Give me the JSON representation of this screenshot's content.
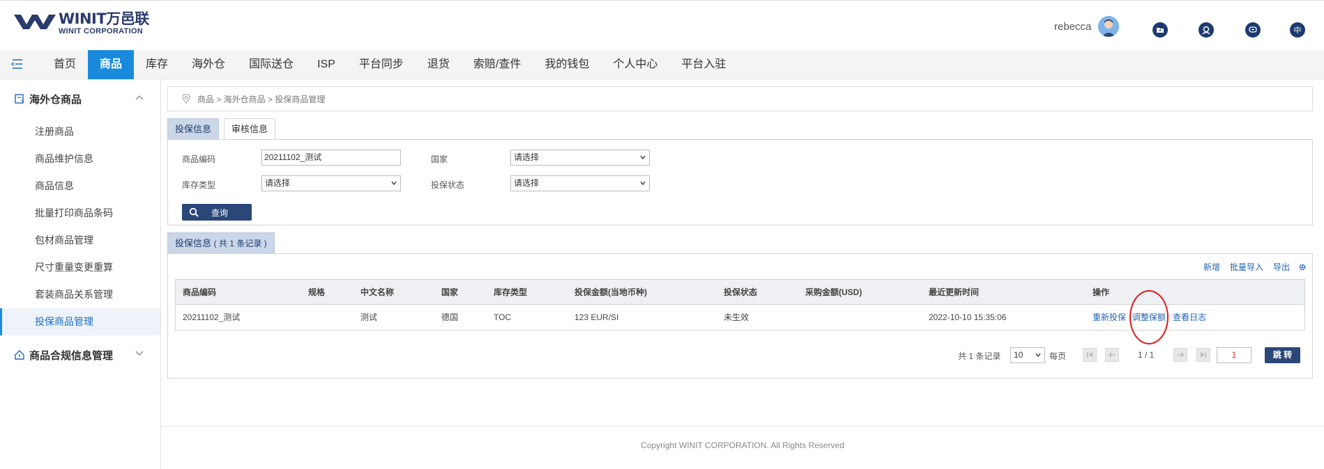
{
  "header": {
    "brand": "WINIT万邑联",
    "brand_sub": "WINIT CORPORATION",
    "user_name": "rebecca",
    "lang_label": "中"
  },
  "nav": {
    "items": [
      "首页",
      "商品",
      "库存",
      "海外仓",
      "国际送仓",
      "ISP",
      "平台同步",
      "退货",
      "索赔/查件",
      "我的钱包",
      "个人中心",
      "平台入驻"
    ],
    "active": "商品"
  },
  "sidebar": {
    "group1": "海外仓商品",
    "items": [
      "注册商品",
      "商品维护信息",
      "商品信息",
      "批量打印商品条码",
      "包材商品管理",
      "尺寸重量变更重算",
      "套装商品关系管理",
      "投保商品管理"
    ],
    "active": "投保商品管理",
    "group2": "商品合规信息管理"
  },
  "breadcrumb": "商品 > 海外仓商品 > 投保商品管理",
  "tabs": [
    "投保信息",
    "审核信息"
  ],
  "search": {
    "product_code_label": "商品编码",
    "product_code_value": "20211102_测试",
    "country_label": "国家",
    "country_value": "请选择",
    "stock_type_label": "库存类型",
    "stock_type_value": "请选择",
    "insure_status_label": "投保状态",
    "insure_status_value": "请选择",
    "query_label": "查询"
  },
  "result": {
    "tab_label": "投保信息",
    "count_label": "( 共 1 条记录 )",
    "toolbar": [
      "新增",
      "批量导入",
      "导出"
    ],
    "columns": [
      "商品编码",
      "规格",
      "中文名称",
      "国家",
      "库存类型",
      "投保金额(当地币种)",
      "投保状态",
      "采购金额(USD)",
      "最近更新时间",
      "操作"
    ],
    "rows": [
      {
        "code": "20211102_测试",
        "spec": "",
        "name": "测试",
        "country": "德国",
        "stock_type": "TOC",
        "amount": "123 EUR/SI",
        "status": "未生效",
        "purchase": "",
        "updated": "2022-10-10 15:35:06",
        "ops": [
          "重新投保",
          "调整保额",
          "查看日志"
        ]
      }
    ]
  },
  "pagination": {
    "total_label": "共 1 条记录",
    "page_size": "10",
    "per_page_label": "每页",
    "page_info": "1 / 1",
    "page_input": "1",
    "go_label": "跳 转"
  },
  "footer": "Copyright WINIT CORPORATION. All Rights Reserved",
  "colors": {
    "primary": "#1a8bdc",
    "dark": "#2b4778",
    "link": "#2463b4",
    "annotation": "#e0191e"
  }
}
